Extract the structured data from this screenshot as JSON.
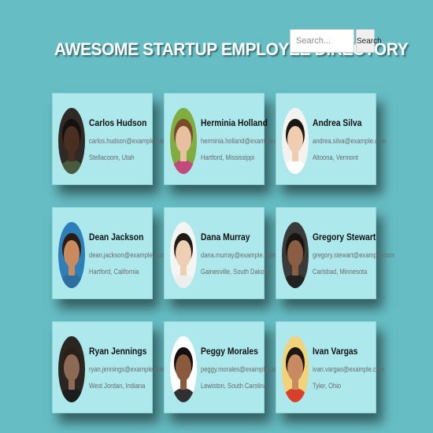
{
  "header": {
    "title": "AWESOME STARTUP EMPLOYEE DIRECTORY"
  },
  "search": {
    "placeholder": "Search...",
    "value": "",
    "button_label": "Search"
  },
  "employees": [
    {
      "name": "Carlos Hudson",
      "email": "carlos.hudson@example.com",
      "location": "Stellacoom, Utah",
      "avatar": {
        "bg": "#2f2a25",
        "skin": "#4a2e1f",
        "hair": "#141110",
        "shirt": "#4a5a3c"
      }
    },
    {
      "name": "Herminia Holland",
      "email": "herminia.holland@example.com",
      "location": "Hartford, Mississippi",
      "avatar": {
        "bg": "#7fae3f",
        "skin": "#e8c0a0",
        "hair": "#7a4a2a",
        "shirt": "#c24a7a"
      }
    },
    {
      "name": "Andrea Silva",
      "email": "andrea.silva@example.com",
      "location": "Altoona, Vermont",
      "avatar": {
        "bg": "#f2f2ee",
        "skin": "#f0cdb0",
        "hair": "#1a1614",
        "shirt": "#ffffff"
      }
    },
    {
      "name": "Dean Jackson",
      "email": "dean.jackson@example.com",
      "location": "Hartford, California",
      "avatar": {
        "bg": "#2d7fb8",
        "skin": "#c98a5e",
        "hair": "#2a1c14",
        "shirt": "#2a6fa0"
      }
    },
    {
      "name": "Dana Murray",
      "email": "dana.murray@example.com",
      "location": "Gainesville, South Dakota",
      "avatar": {
        "bg": "#f4f4f2",
        "skin": "#efcfb4",
        "hair": "#201a16",
        "shirt": "#eeeeee"
      }
    },
    {
      "name": "Gregory Stewart",
      "email": "gregory.stewart@example.com",
      "location": "Carlsbad, Minnesota",
      "avatar": {
        "bg": "#3a3a3a",
        "skin": "#8a5e42",
        "hair": "#1a1410",
        "shirt": "#222222"
      }
    },
    {
      "name": "Ryan Jennings",
      "email": "ryan.jennings@example.com",
      "location": "West Jordan, Indiana",
      "avatar": {
        "bg": "#2c2622",
        "skin": "#8c6a55",
        "hair": "#2a2018",
        "shirt": "#1c1c1c"
      }
    },
    {
      "name": "Peggy Morales",
      "email": "peggy.morales@example.com",
      "location": "Lewiston, South Carolina",
      "avatar": {
        "bg": "#ffffff",
        "skin": "#8a5a3e",
        "hair": "#141010",
        "shirt": "#303030"
      }
    },
    {
      "name": "Ivan Vargas",
      "email": "ivan.vargas@example.com",
      "location": "Tyler, Ohio",
      "avatar": {
        "bg": "#f3d37a",
        "skin": "#c88a60",
        "hair": "#1e1612",
        "shirt": "#d8402a"
      }
    }
  ]
}
